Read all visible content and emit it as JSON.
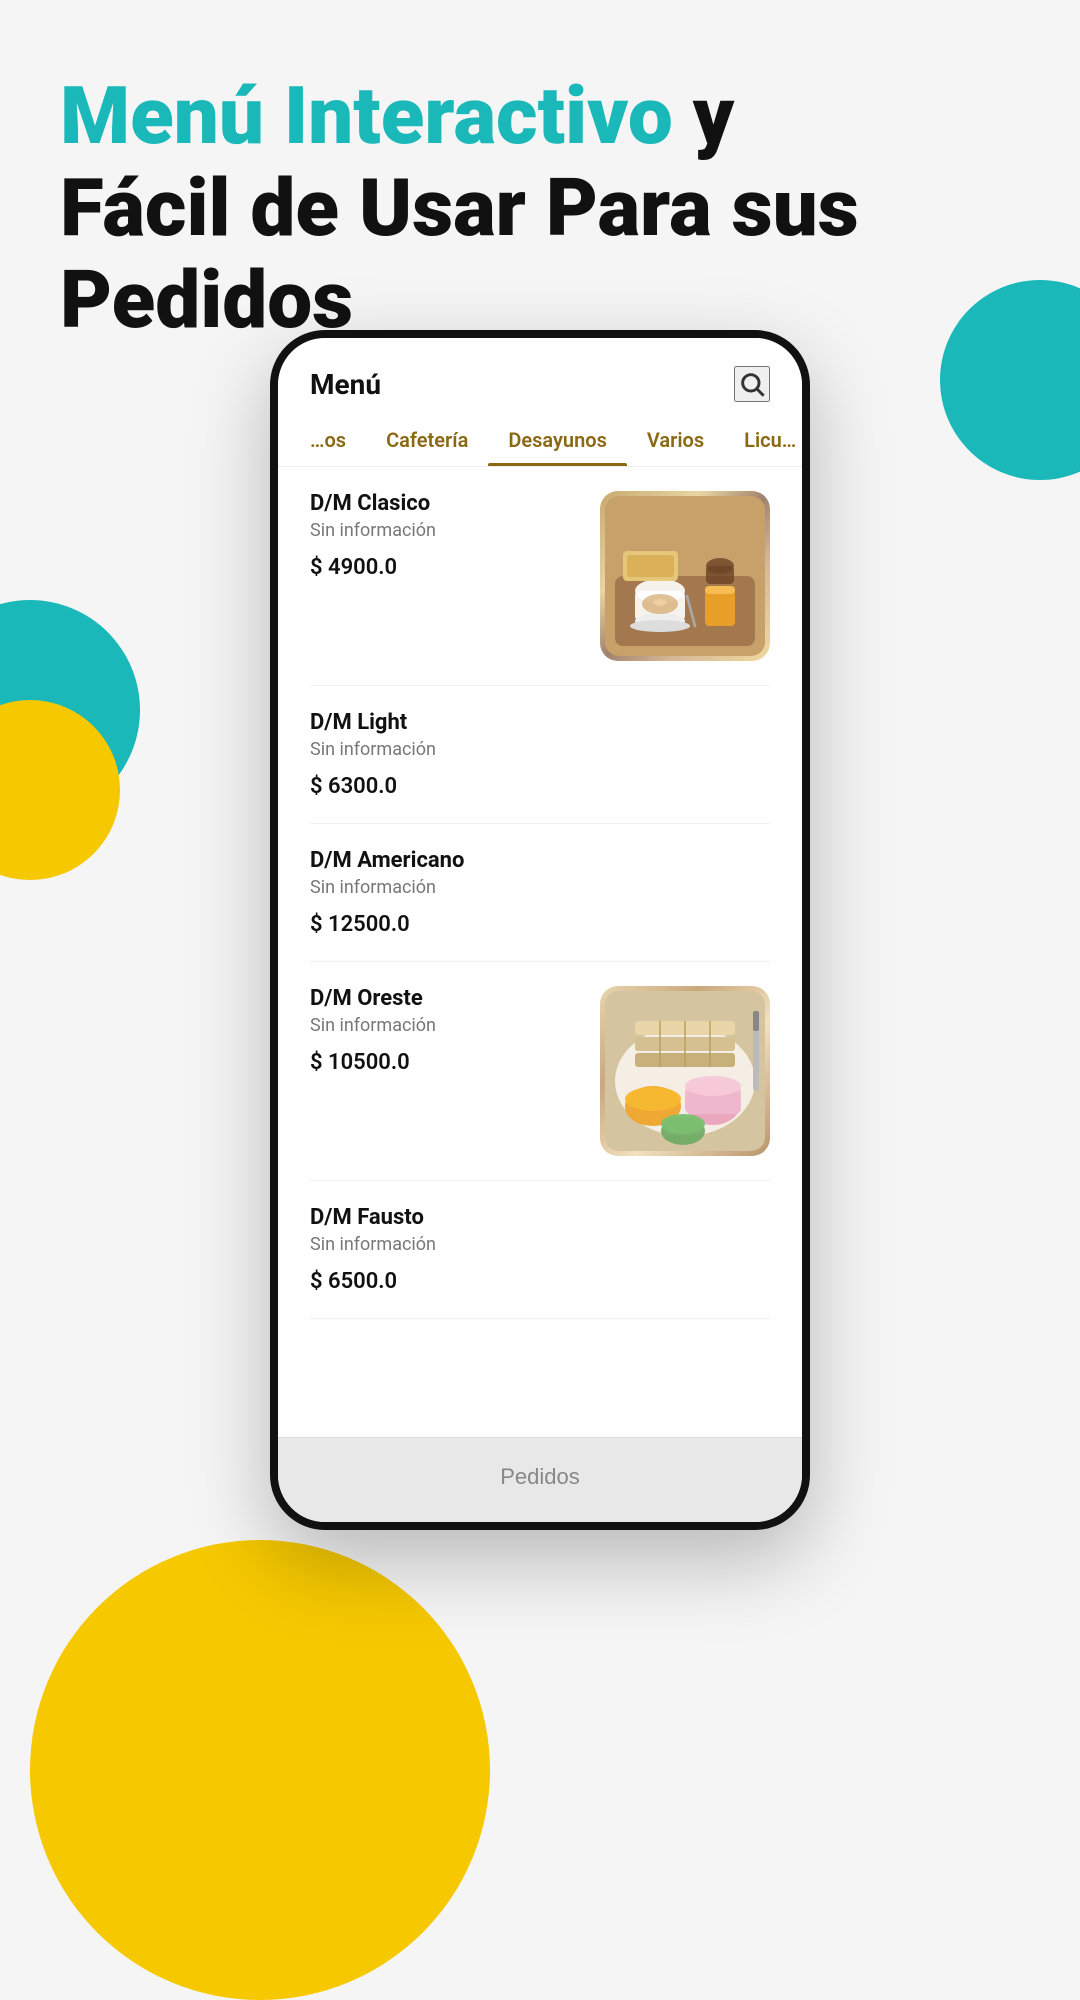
{
  "header": {
    "line1_teal": "Menú Interactivo",
    "line1_rest": " y",
    "line2": "Fácil de Usar Para sus",
    "line3": "Pedidos"
  },
  "phone": {
    "title": "Menú",
    "search_label": "search"
  },
  "tabs": [
    {
      "id": "otros",
      "label": "…os",
      "active": false
    },
    {
      "id": "cafeteria",
      "label": "Cafetería",
      "active": false
    },
    {
      "id": "desayunos",
      "label": "Desayunos",
      "active": true
    },
    {
      "id": "varios",
      "label": "Varios",
      "active": false
    },
    {
      "id": "licua",
      "label": "Licu…",
      "active": false
    }
  ],
  "menu_items": [
    {
      "id": 1,
      "name": "D/M Clasico",
      "description": "Sin información",
      "price": "$ 4900.0",
      "has_image": true,
      "image_type": "food1"
    },
    {
      "id": 2,
      "name": "D/M Light",
      "description": "Sin información",
      "price": "$ 6300.0",
      "has_image": false,
      "image_type": null
    },
    {
      "id": 3,
      "name": "D/M Americano",
      "description": "Sin información",
      "price": "$ 12500.0",
      "has_image": false,
      "image_type": null
    },
    {
      "id": 4,
      "name": "D/M Oreste",
      "description": "Sin información",
      "price": "$ 10500.0",
      "has_image": true,
      "image_type": "food2"
    },
    {
      "id": 5,
      "name": "D/M Fausto",
      "description": "Sin información",
      "price": "$ 6500.0",
      "has_image": false,
      "image_type": null
    }
  ],
  "bottom_bar": {
    "label": "Pedidos"
  },
  "colors": {
    "teal": "#1ab8b8",
    "yellow": "#f5c800",
    "tab_active": "#8B6914",
    "text_primary": "#111111",
    "text_secondary": "#777777"
  }
}
